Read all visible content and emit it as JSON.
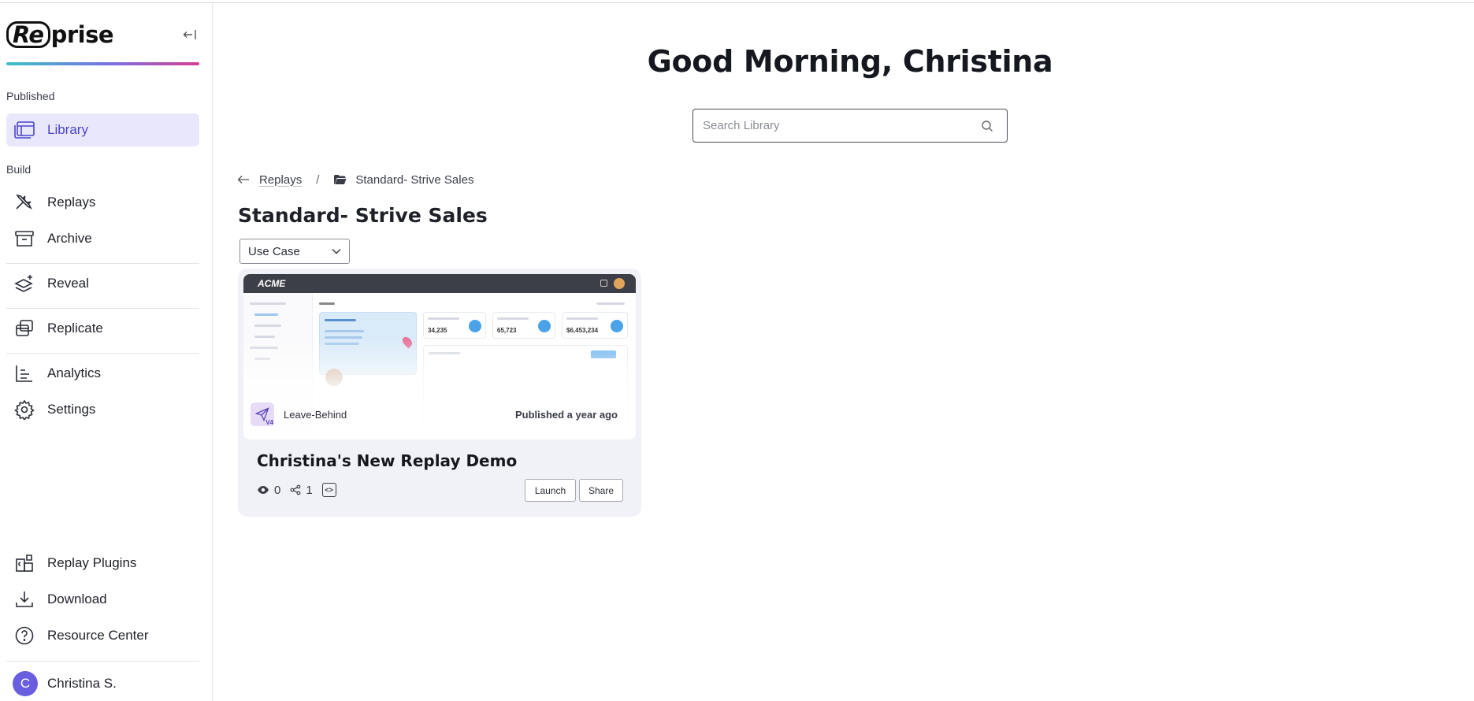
{
  "brand": {
    "logo_boxed": "Re",
    "logo_rest": "prise"
  },
  "sidebar": {
    "sections": {
      "published": "Published",
      "build": "Build"
    },
    "items": [
      {
        "label": "Library",
        "icon": "library-icon"
      },
      {
        "label": "Replays",
        "icon": "tools-icon"
      },
      {
        "label": "Archive",
        "icon": "archive-icon"
      },
      {
        "label": "Reveal",
        "icon": "layers-sparkle-icon"
      },
      {
        "label": "Replicate",
        "icon": "copy-windows-icon"
      },
      {
        "label": "Analytics",
        "icon": "bar-chart-icon"
      },
      {
        "label": "Settings",
        "icon": "gear-icon"
      },
      {
        "label": "Replay Plugins",
        "icon": "puzzle-icon"
      },
      {
        "label": "Download",
        "icon": "download-icon"
      },
      {
        "label": "Resource Center",
        "icon": "help-circle-icon"
      }
    ],
    "user": {
      "initial": "C",
      "name": "Christina S."
    }
  },
  "main": {
    "greeting": "Good Morning, Christina",
    "search": {
      "placeholder": "Search Library",
      "value": ""
    },
    "breadcrumb": {
      "parent": "Replays",
      "separator": "/",
      "current": "Standard- Strive Sales"
    },
    "folder_title": "Standard- Strive Sales",
    "filter": {
      "selected": "Use Case"
    },
    "card": {
      "thumbnail": {
        "brand": "ACME"
      },
      "type_label": "Leave-Behind",
      "version": "V4",
      "published": "Published a year ago",
      "title": "Christina's New Replay Demo",
      "views": "0",
      "shares": "1",
      "launch_label": "Launch",
      "share_label": "Share"
    }
  },
  "colors": {
    "accent": "#4b45c9",
    "active_bg": "#e9e7fb",
    "avatar": "#6a5ee0",
    "card_bg": "#f1f2f7"
  }
}
